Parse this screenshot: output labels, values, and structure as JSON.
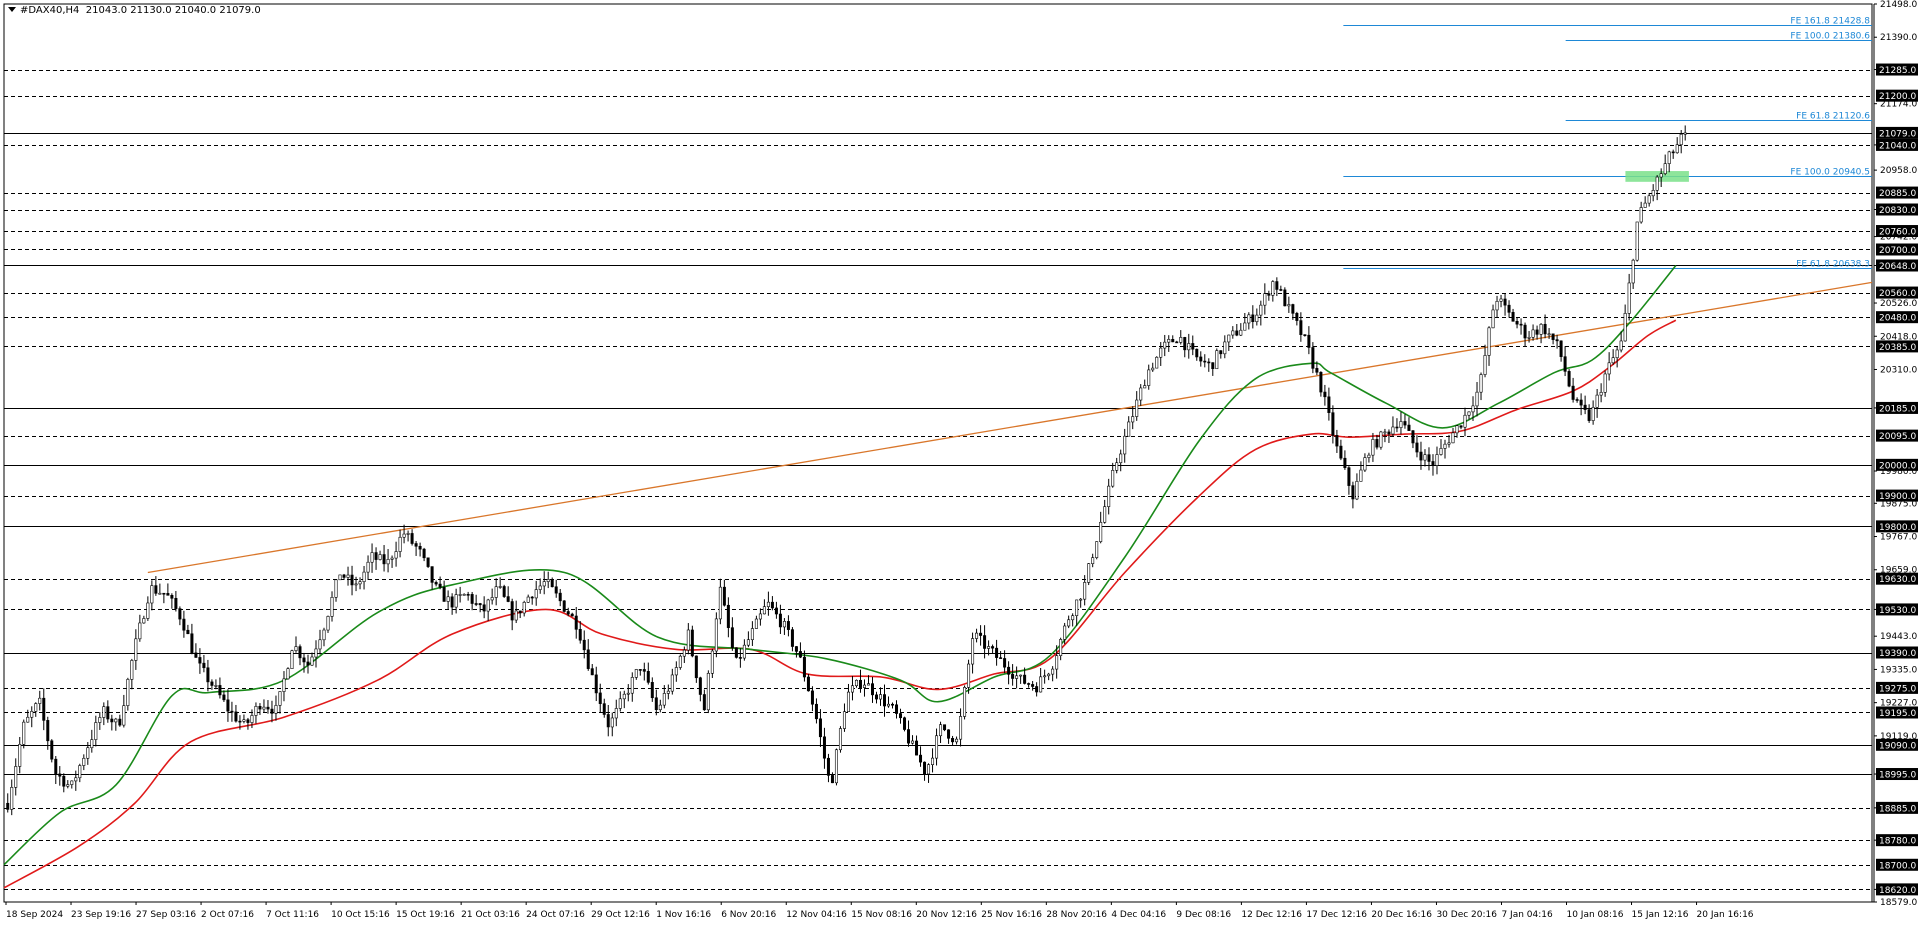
{
  "header": {
    "symbol": "#DAX40,H4",
    "ohlc": "21043.0 21130.0 21040.0 21079.0"
  },
  "colors": {
    "background": "#ffffff",
    "grid": "#000000",
    "candle_up": "#000000",
    "candle_down": "#000000",
    "ma_fast": "#1a8a1a",
    "ma_slow": "#e01a1a",
    "trendline": "#d9762a",
    "fibo": "#1e88d6",
    "zone": "#7ae08a"
  },
  "chart_data": {
    "type": "candlestick",
    "ylim": [
      18579.0,
      21498.0
    ],
    "price_labels": [
      "21498.0",
      "21390.0",
      "21285.0",
      "21174.0",
      "21040.0",
      "20958.0",
      "20830.0",
      "20742.0",
      "20648.0",
      "20526.0",
      "20418.0",
      "20310.0",
      "20185.0",
      "19980.0",
      "19875.0",
      "19767.0",
      "19659.0",
      "19530.0",
      "19443.0",
      "19335.0",
      "19227.0",
      "19119.0",
      "18995.0",
      "18885.0",
      "18780.0",
      "18620.0",
      "18579.0"
    ],
    "level_labels": [
      "21285.0",
      "21200.0",
      "21079.0",
      "21040.0",
      "20885.0",
      "20830.0",
      "20760.0",
      "20700.0",
      "20648.0",
      "20560.0",
      "20480.0",
      "20385.0",
      "20185.0",
      "20095.0",
      "20000.0",
      "19900.0",
      "19800.0",
      "19630.0",
      "19530.0",
      "19390.0",
      "19275.0",
      "19195.0",
      "19090.0",
      "18995.0",
      "18885.0",
      "18780.0",
      "18700.0",
      "18620.0"
    ],
    "levels": [
      {
        "price": 21285,
        "style": "dashed"
      },
      {
        "price": 21200,
        "style": "dashed"
      },
      {
        "price": 21079,
        "style": "solid"
      },
      {
        "price": 21040,
        "style": "dashed"
      },
      {
        "price": 20885,
        "style": "dashed"
      },
      {
        "price": 20830,
        "style": "dashed"
      },
      {
        "price": 20760,
        "style": "dashed"
      },
      {
        "price": 20700,
        "style": "dashed"
      },
      {
        "price": 20648,
        "style": "solid"
      },
      {
        "price": 20560,
        "style": "dashed"
      },
      {
        "price": 20480,
        "style": "dashed"
      },
      {
        "price": 20385,
        "style": "dashed"
      },
      {
        "price": 20185,
        "style": "solid"
      },
      {
        "price": 20095,
        "style": "dashed"
      },
      {
        "price": 20000,
        "style": "solid"
      },
      {
        "price": 19900,
        "style": "dashed"
      },
      {
        "price": 19800,
        "style": "solid"
      },
      {
        "price": 19630,
        "style": "dashed"
      },
      {
        "price": 19530,
        "style": "dashed"
      },
      {
        "price": 19390,
        "style": "solid"
      },
      {
        "price": 19275,
        "style": "dashed"
      },
      {
        "price": 19195,
        "style": "dashed"
      },
      {
        "price": 19090,
        "style": "solid"
      },
      {
        "price": 18995,
        "style": "solid"
      },
      {
        "price": 18885,
        "style": "dashed"
      },
      {
        "price": 18780,
        "style": "dashed"
      },
      {
        "price": 18700,
        "style": "dashed"
      },
      {
        "price": 18620,
        "style": "dashed"
      }
    ],
    "x_labels": [
      "18 Sep 2024",
      "23 Sep 19:16",
      "27 Sep 03:16",
      "2 Oct 07:16",
      "7 Oct 11:16",
      "10 Oct 15:16",
      "15 Oct 19:16",
      "21 Oct 03:16",
      "24 Oct 07:16",
      "29 Oct 12:16",
      "1 Nov 16:16",
      "6 Nov 20:16",
      "12 Nov 04:16",
      "15 Nov 08:16",
      "20 Nov 12:16",
      "25 Nov 16:16",
      "28 Nov 20:16",
      "4 Dec 04:16",
      "9 Dec 08:16",
      "12 Dec 12:16",
      "17 Dec 12:16",
      "20 Dec 16:16",
      "30 Dec 20:16",
      "7 Jan 04:16",
      "10 Jan 08:16",
      "15 Jan 12:16",
      "20 Jan 16:16"
    ],
    "closes": [
      18900,
      19150,
      19230,
      19000,
      18950,
      19080,
      19200,
      19150,
      19400,
      19600,
      19580,
      19500,
      19350,
      19280,
      19200,
      19150,
      19230,
      19200,
      19420,
      19350,
      19480,
      19650,
      19600,
      19700,
      19680,
      19780,
      19720,
      19600,
      19550,
      19580,
      19520,
      19600,
      19500,
      19580,
      19620,
      19550,
      19480,
      19300,
      19150,
      19250,
      19350,
      19200,
      19300,
      19450,
      19200,
      19600,
      19350,
      19450,
      19550,
      19480,
      19380,
      19200,
      18950,
      19250,
      19300,
      19250,
      19200,
      19100,
      19000,
      19150,
      19100,
      19450,
      19400,
      19350,
      19300,
      19280,
      19350,
      19500,
      19600,
      19800,
      20000,
      20150,
      20300,
      20380,
      20420,
      20350,
      20320,
      20400,
      20450,
      20500,
      20600,
      20500,
      20400,
      20250,
      20050,
      19900,
      20050,
      20100,
      20150,
      20050,
      20000,
      20080,
      20150,
      20250,
      20550,
      20480,
      20420,
      20450,
      20380,
      20200,
      20150,
      20300,
      20400,
      20800,
      20900,
      21000,
      21079
    ],
    "ma_fast": {
      "x_frac": [
        0.0,
        0.03,
        0.06,
        0.09,
        0.11,
        0.15,
        0.2,
        0.24,
        0.3,
        0.35,
        0.4,
        0.44,
        0.48,
        0.5,
        0.53,
        0.56,
        0.6,
        0.64,
        0.67,
        0.7,
        0.71,
        0.74,
        0.77,
        0.8,
        0.83,
        0.85,
        0.87,
        0.895
      ],
      "y": [
        18700,
        18870,
        18960,
        19250,
        19260,
        19300,
        19520,
        19610,
        19650,
        19440,
        19400,
        19370,
        19300,
        19230,
        19310,
        19380,
        19700,
        20080,
        20280,
        20330,
        20300,
        20200,
        20120,
        20200,
        20300,
        20340,
        20460,
        20648
      ]
    },
    "ma_slow": {
      "x_frac": [
        0.0,
        0.04,
        0.07,
        0.1,
        0.15,
        0.2,
        0.24,
        0.29,
        0.32,
        0.36,
        0.4,
        0.43,
        0.47,
        0.5,
        0.53,
        0.56,
        0.6,
        0.64,
        0.67,
        0.7,
        0.72,
        0.75,
        0.78,
        0.81,
        0.84,
        0.86,
        0.88,
        0.895
      ],
      "y": [
        18625,
        18760,
        18900,
        19100,
        19180,
        19300,
        19450,
        19530,
        19450,
        19400,
        19400,
        19320,
        19310,
        19270,
        19320,
        19370,
        19650,
        19900,
        20050,
        20100,
        20090,
        20100,
        20110,
        20180,
        20240,
        20320,
        20420,
        20470
      ]
    },
    "trendline": {
      "from": {
        "x_frac": 0.077,
        "y": 19650
      },
      "to": {
        "x_frac": 1.0,
        "y": 20593
      }
    },
    "fibo_levels": [
      {
        "label": "FE 161.8 21428.8",
        "price": 21428.8,
        "start_frac": 0.717
      },
      {
        "label": "FE 100.0 21380.6",
        "price": 21380.6,
        "start_frac": 0.836
      },
      {
        "label": "FE 61.8 21120.6",
        "price": 21120.6,
        "start_frac": 0.836
      },
      {
        "label": "FE 100.0 20940.5",
        "price": 20940.5,
        "start_frac": 0.717
      },
      {
        "label": "FE 61.8 20638.3",
        "price": 20638.3,
        "start_frac": 0.717
      }
    ],
    "zone": {
      "price_low": 20920,
      "price_high": 20955,
      "x_start_frac": 0.868,
      "x_end_frac": 0.902
    }
  }
}
